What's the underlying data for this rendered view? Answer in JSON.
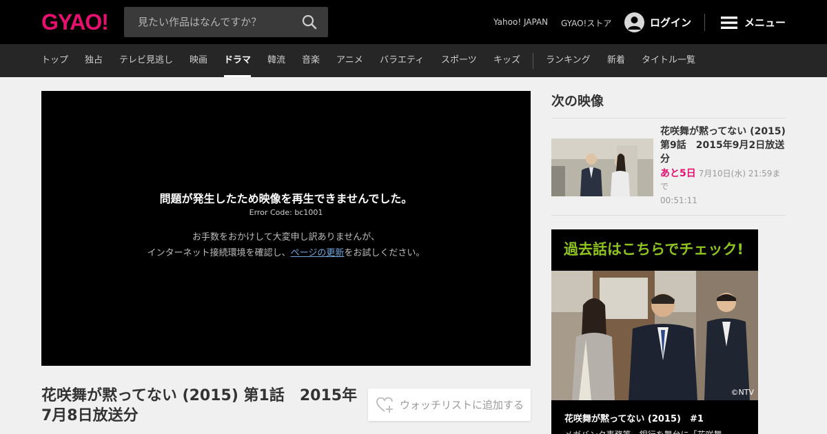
{
  "header": {
    "logo": "GYAO!",
    "search_placeholder": "見たい作品はなんですか？",
    "links": [
      "Yahoo! JAPAN",
      "GYAO!ストア"
    ],
    "login_label": "ログイン",
    "menu_label": "メニュー",
    "logo_color": "#e6106e"
  },
  "nav": {
    "items": [
      "トップ",
      "独占",
      "テレビ見逃し",
      "映画",
      "ドラマ",
      "韓流",
      "音楽",
      "アニメ",
      "バラエティ",
      "スポーツ",
      "キッズ"
    ],
    "secondary": [
      "ランキング",
      "新着",
      "タイトル一覧"
    ],
    "active": "ドラマ"
  },
  "player": {
    "error_title": "問題が発生したため映像を再生できませんでした。",
    "error_code": "Error Code: bc1001",
    "error_line1": "お手数をおかけして大変申し訳ありませんが、",
    "error_line2_pre": "インターネット接続環境を確認し、",
    "error_link": "ページの更新",
    "error_line2_post": "をお試しください。"
  },
  "episode": {
    "title": "花咲舞が黙ってない (2015) 第1話　2015年7月8日放送分",
    "watchlist_label": "ウォッチリストに追加する"
  },
  "sidebar": {
    "next_heading": "次の映像",
    "next": {
      "title": "花咲舞が黙ってない (2015) 第9話　2015年9月2日放送分",
      "remaining": "あと5日",
      "deadline": "7月10日(水) 21:59まで",
      "duration": "00:51:11"
    },
    "promo": {
      "heading": "過去話はこちらでチェック!",
      "credit": "©NTV",
      "caption": "花咲舞が黙ってない (2015)　#1",
      "sub": "メガバンク事務等…銀行を舞台に「花咲舞"
    }
  }
}
